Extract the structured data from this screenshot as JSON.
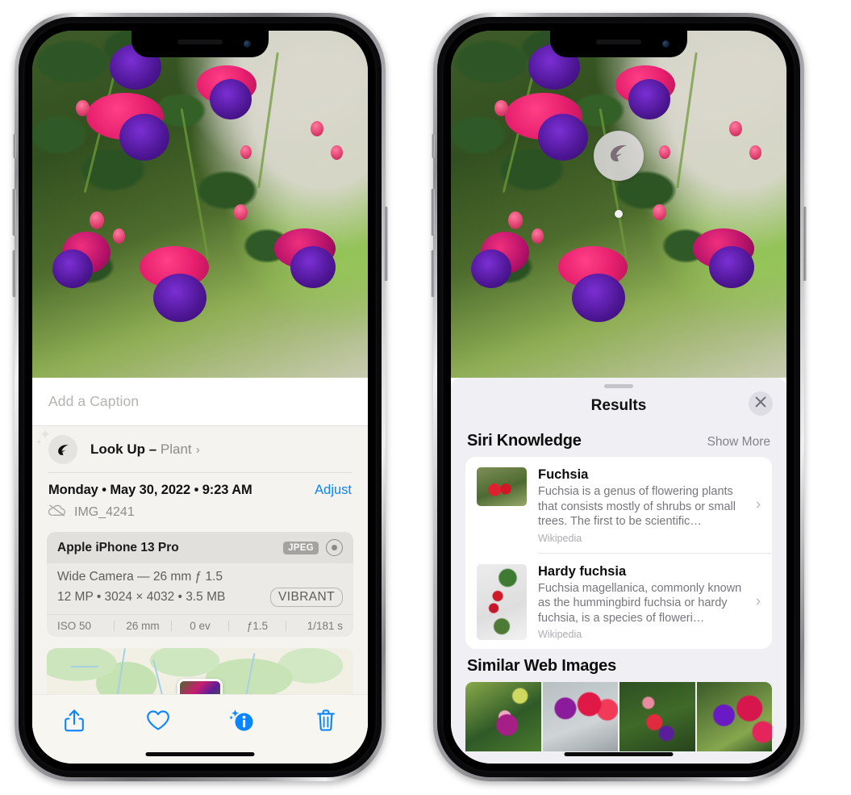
{
  "left_phone": {
    "caption": {
      "placeholder": "Add a Caption",
      "value": ""
    },
    "look_up": {
      "label": "Look Up – ",
      "subject": "Plant",
      "chevron": "›",
      "icon": "leaf-icon"
    },
    "metadata": {
      "date_line": "Monday • May 30, 2022 • 9:23 AM",
      "adjust_label": "Adjust",
      "filename": "IMG_4241",
      "cloud_icon": "cloud-slash-icon"
    },
    "camera_card": {
      "model": "Apple iPhone 13 Pro",
      "format_tag": "JPEG",
      "raw_icon": "raw-circle-icon",
      "lens_line": "Wide Camera — 26 mm ƒ 1.5",
      "size_line": "12 MP • 3024 × 4032 • 3.5 MB",
      "style_tag": "VIBRANT",
      "exif": [
        "ISO 50",
        "26 mm",
        "0 ev",
        "ƒ1.5",
        "1/181 s"
      ]
    },
    "toolbar": [
      {
        "name": "share-button",
        "icon": "share-icon"
      },
      {
        "name": "favorite-button",
        "icon": "heart-icon"
      },
      {
        "name": "info-button",
        "icon": "info-sparkle-icon"
      },
      {
        "name": "delete-button",
        "icon": "trash-icon"
      }
    ],
    "accent_color": "#0a84ff"
  },
  "right_phone": {
    "photo_badge": {
      "icon": "leaf-icon",
      "name": "visual-lookup-badge"
    },
    "sheet": {
      "title": "Results",
      "close_icon": "close-x-icon",
      "siri_knowledge": {
        "heading": "Siri Knowledge",
        "show_more": "Show More",
        "items": [
          {
            "title": "Fuchsia",
            "description": "Fuchsia is a genus of flowering plants that consists mostly of shrubs or small trees. The first to be scientific…",
            "source": "Wikipedia",
            "chevron": "›"
          },
          {
            "title": "Hardy fuchsia",
            "description": "Fuchsia magellanica, commonly known as the hummingbird fuchsia or hardy fuchsia, is a species of floweri…",
            "source": "Wikipedia",
            "chevron": "›"
          }
        ]
      },
      "similar_web_images": {
        "heading": "Similar Web Images",
        "count": 4
      }
    }
  }
}
